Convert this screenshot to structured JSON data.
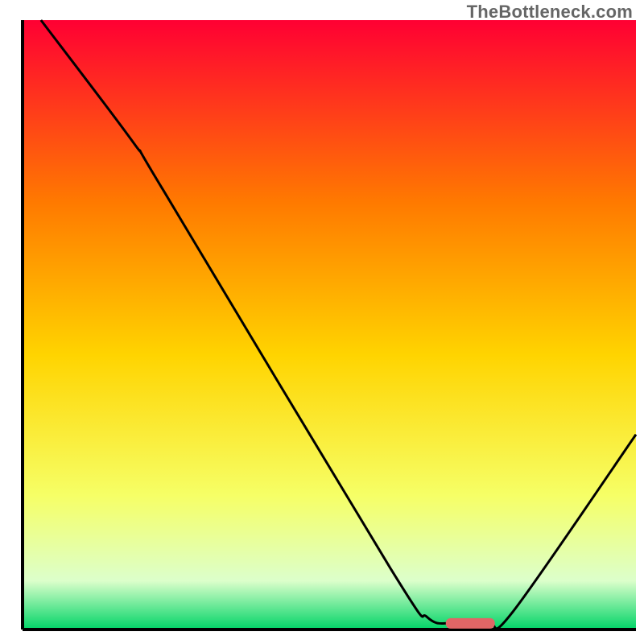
{
  "watermark": "TheBottleneck.com",
  "chart_data": {
    "type": "line",
    "title": "",
    "xlabel": "",
    "ylabel": "",
    "x_range": [
      0,
      100
    ],
    "y_range": [
      0,
      100
    ],
    "gradient": {
      "top": "#ff0033",
      "upper_mid": "#ff7a00",
      "mid": "#ffd400",
      "lower_mid": "#f6ff66",
      "near_bottom": "#dcffcb",
      "bottom": "#00d467"
    },
    "series": [
      {
        "name": "curve",
        "color": "#000000",
        "stroke_width": 3,
        "points": [
          {
            "x": 3,
            "y": 100
          },
          {
            "x": 18,
            "y": 80
          },
          {
            "x": 23,
            "y": 72
          },
          {
            "x": 60,
            "y": 10
          },
          {
            "x": 66,
            "y": 2
          },
          {
            "x": 70,
            "y": 1
          },
          {
            "x": 76,
            "y": 1
          },
          {
            "x": 80,
            "y": 3
          },
          {
            "x": 100,
            "y": 32
          }
        ]
      }
    ],
    "marker": {
      "name": "optimum",
      "x_center": 73,
      "y": 1,
      "width": 8,
      "color": "#e06666"
    },
    "axes": {
      "plot_left": 28,
      "plot_right": 790,
      "plot_top": 25,
      "plot_bottom": 782,
      "axis_color": "#000000",
      "axis_width": 4
    }
  }
}
